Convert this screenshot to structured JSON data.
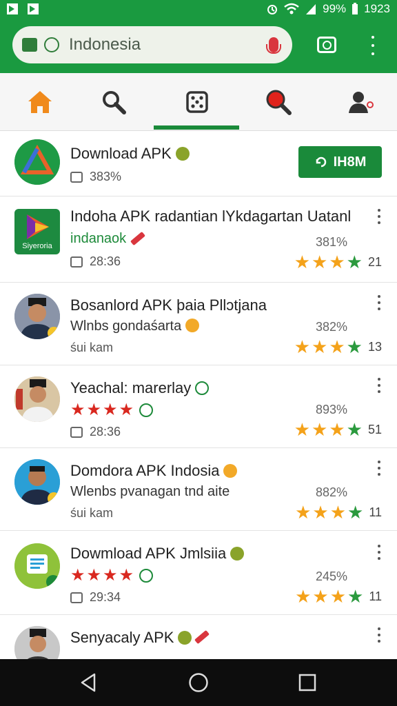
{
  "status": {
    "battery": "99%",
    "time": "1923"
  },
  "search": {
    "query": "Indonesia"
  },
  "tabs": [
    {
      "name": "home",
      "icon": "home-icon"
    },
    {
      "name": "search",
      "icon": "search-icon"
    },
    {
      "name": "games",
      "icon": "dice-icon"
    },
    {
      "name": "discover",
      "icon": "search-red-icon"
    },
    {
      "name": "account",
      "icon": "person-icon"
    }
  ],
  "colors": {
    "brand": "#1a9a40",
    "star": "#f4a21a",
    "star_green": "#2b9a3e",
    "red_star": "#d9281f"
  },
  "items": [
    {
      "title": "Download APK",
      "meta": "383%",
      "install_label": "IH8M"
    },
    {
      "title": "Indoha APK radantian lYkdagartan Uatanl",
      "subtitle": "indanaok",
      "meta": "28:36",
      "pct": "381%",
      "rating": "21",
      "logo_text": "Siyeroria"
    },
    {
      "title": "Bosanlord APK þaia Pllɔtjana",
      "subtitle": "Wlnbs gondaśarta",
      "meta": "śui kam",
      "pct": "382%",
      "rating": "13"
    },
    {
      "title": "Yeachal: marerlay",
      "red_stars": "★★★★",
      "meta": "28:36",
      "pct": "893%",
      "rating": "51"
    },
    {
      "title": "Domdora APK Indosia",
      "subtitle": "Wlenbs pvanagan tnd aite",
      "meta": "śui kam",
      "pct": "882%",
      "rating": "11"
    },
    {
      "title": "Dowmload APK Jmlsiia",
      "red_stars": "★★★★",
      "meta": "29:34",
      "pct": "245%",
      "rating": "11"
    },
    {
      "title": "Senyacaly APK"
    }
  ]
}
